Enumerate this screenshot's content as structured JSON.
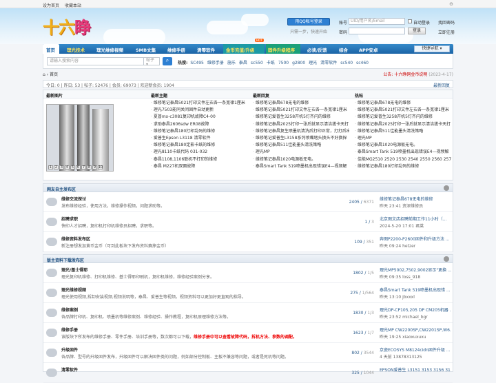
{
  "topbar": {
    "set_home": "设为首页",
    "bookmark": "收藏本站",
    "toggle": "⊖"
  },
  "logo": {
    "part1": "十六",
    "part2": "睁"
  },
  "login": {
    "qq_button": "用QQ帐号登录",
    "qq_sub": "只需一步，快速开始",
    "account_label": "账号",
    "account_placeholder": "UID/用户名/Email",
    "password_label": "密码",
    "auto_login": "自动登录",
    "login_button": "登录",
    "forgot": "找回密码",
    "register": "立即注册"
  },
  "nav": {
    "items": [
      "首页",
      "理光技术",
      "理光维修视频",
      "SMB文集",
      "维修手册",
      "清零软件",
      "金币充值/升级",
      "固件升级程序",
      "必读/反馈",
      "综合",
      "APP安卓"
    ],
    "hot_badge": "HOT",
    "fast_nav": "快捷导航 ▾"
  },
  "search": {
    "placeholder": "请输入搜索内容",
    "type": "帖子 ▾",
    "button": "⌕",
    "hot_label": "热搜:",
    "hot_words": [
      "SC495",
      "维修手册",
      "施乐",
      "泰昌",
      "sc550",
      "卡纸",
      "7500",
      "g2800",
      "理光",
      "清零软件",
      "sc540",
      "sc460"
    ]
  },
  "breadcrumb": {
    "home_icon": "⌂",
    "sep": "›",
    "current": "首页",
    "notice": "公告: 十六睁网金币说明",
    "notice_date": "(2023-4-17)"
  },
  "stats": {
    "text": "今日: 0 | 昨日: 53 | 帖子: 52476 | 会员: 69073 | 欢迎新会员: 1904",
    "latest": "最新回复"
  },
  "grid": {
    "headers": [
      "最新图片",
      "最新主题",
      "最新回复",
      "热帖"
    ],
    "pic_pages": [
      "1",
      "2",
      "3",
      "4",
      "5",
      "6",
      "7",
      "8",
      "9",
      "10"
    ],
    "new_topics": [
      "维修笔记泰昌5021打印文件左右各一条宽律1厘米",
      "理光7503能同关闭固件自动更新",
      "夏普mx-c3081复印机故障C4-00",
      "求助泰昌2606sdw ER08故障",
      "维修笔记泰昌180打印乱码的维修",
      "爱普生Epson L3118 清零软件",
      "维修笔记泰昌180定影卡纸的维修",
      "理光8110卡纸代码 031-032",
      "泰昌1108,1106联机不打印的维修",
      "泰昌 M227机双面故障"
    ],
    "new_replies": [
      "维修笔记泰昌678无电的维修",
      "维修笔记泰昌5021打印文件左右各一条宽律1厘米",
      "维修笔记爱普生3258开机5灯齐闪的维修",
      "维修笔记泰昌2025打印一张后就显示清洁搓卡天打",
      "维修笔记泰昌复生喷墨机清洗后打印正常，打打后出",
      "维修笔记爱普生L3158系列喷嘴堵头换头不好换探",
      "维修笔记泰昌511佳能墨头清洗策略",
      "理光MP",
      "维修笔记泰昌1020电源板无电。",
      "泰昌Smart Tank 519喷墨机出现错误E4—视频解"
    ],
    "hot_posts": [
      "维修笔记泰昌678无电的维修",
      "维修笔记泰昌5021打印文件左右各一条宽律1厘米",
      "维修笔记爱普生3258开机5灯齐闪的维修",
      "维修笔记泰昌2025打印一张后就显示清洁搓卡天打",
      "维修笔记泰昌511佳能墨头清洗策略",
      "理光MP",
      "维修笔记泰昌1020电源板无电。",
      "泰昌Smart Tank 519喷墨机出现错误E4—视频解",
      "佳能MG2510 2520 2530 2540 2550 2560 2570",
      "维修笔记泰昌180打印乱码的维修"
    ]
  },
  "section1": {
    "title": "网友自主发布区",
    "forums": [
      {
        "name": "维修交流探讨",
        "desc": "发布维修经验，使用方法，维修操作视频，问题求助等。",
        "threads": "2405",
        "posts": "6371",
        "last_title": "维修笔记泰昌678无电的维修",
        "last_meta": "昨天 23:41 资深维修员"
      },
      {
        "name": "招聘求职",
        "desc": "快印人才招聘，复印机打印机维修员招聘，求职等。",
        "threads": "1",
        "posts": "3",
        "last_title": "北京图文店招聘前期工作11小时（...",
        "last_meta": "2024-5-20 17:01 君莱"
      },
      {
        "name": "维修资料发布区",
        "desc": "新注册想发加黄币金币（可到此板块下发布资料赛挣金币）",
        "threads": "109",
        "posts": "351",
        "last_title": "奔图P2200-P2600固件和升级方法 ...",
        "last_meta": "昨天 09:24 hetzer"
      }
    ]
  },
  "section2": {
    "title": "版主资料下载发布区",
    "forums": [
      {
        "name": "理光/基士得耶",
        "desc": "理光复印机维修、打印机维修、基士得耶印刷机，复印机维修，维修经验案例分享。",
        "desc_red": "",
        "threads": "1802",
        "posts": "1/5",
        "last_title": "理光MP5002,7502,9002显示\"更换 ...",
        "last_meta": "昨天 09:35 loss_918"
      },
      {
        "name": "理光维修视频",
        "desc": "理光使用视频,拆卸安装视频,视频说明等，泰昌、爱普生等视频。视频资料可以更加好更直观的指导。",
        "desc_red": "",
        "threads": "275",
        "posts": "1/564",
        "last_title": "泰昌Smart Tank 519喷墨机出现错 ...",
        "last_meta": "昨天 13:10 jbxxxl"
      },
      {
        "name": "维修案例",
        "desc": "各品牌打印机、复印机、喷墨机等维修案例、维修经验、操作教程，复印机原理维修方法等。",
        "desc_red": "",
        "threads": "1830",
        "posts": "1/3",
        "last_title": "理光DP-CP105,205 DP CM205机器 ...",
        "last_meta": "昨天 23:52 michael_bgr"
      },
      {
        "name": "维修手册",
        "desc": "该版块下所发布的维修手册、零件手册、培训手册等，数次都可以下载，",
        "desc_red": "维修手册中可以查看故障代码，拆机方法、参数的调配。",
        "threads": "1623",
        "posts": "1/7",
        "last_title": "理光MP CW2200SP,CW2201SP,W6...",
        "last_meta": "昨天 19:25 xiaoxuxuxu"
      },
      {
        "name": "升级固件",
        "desc": "各品牌、型号的升级固件发布，升级固件可以解决固件类的问题，例如部分控制板、主板不兼容等问题，或者是死机等问题。",
        "desc_red": "",
        "threads": "802",
        "posts": "3544",
        "last_title": "京瓷ECOSYS M8124cidn固件升级 ...",
        "last_meta": "4 天前 13878313125"
      },
      {
        "name": "清零软件",
        "desc": "",
        "desc_red": "",
        "threads": "325",
        "posts": "1044",
        "last_title": "EPSON爱普生 L3151 3153 3156 31 ...",
        "last_meta": ""
      }
    ]
  },
  "colors": {
    "nav": "#1c64a6",
    "accent_red": "#e00000",
    "link": "#2a5b8c"
  }
}
